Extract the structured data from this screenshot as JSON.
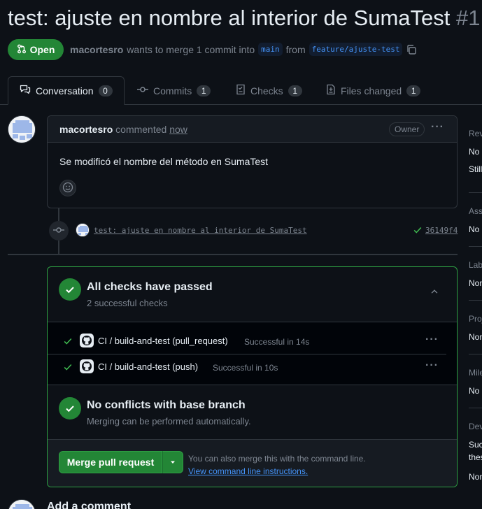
{
  "pr": {
    "title": "test: ajuste en nombre al interior de SumaTest",
    "number": "#1",
    "state": "Open",
    "author": "macortesro",
    "meta_text": "wants to merge 1 commit into",
    "base_branch": "main",
    "from_text": "from",
    "head_branch": "feature/ajuste-test"
  },
  "tabs": [
    {
      "label": "Conversation",
      "count": "0"
    },
    {
      "label": "Commits",
      "count": "1"
    },
    {
      "label": "Checks",
      "count": "1"
    },
    {
      "label": "Files changed",
      "count": "1"
    }
  ],
  "comment": {
    "author": "macortesro",
    "action": "commented",
    "time": "now",
    "role": "Owner",
    "body": "Se modificó el nombre del método en SumaTest"
  },
  "commit": {
    "message": "test: ajuste en nombre al interior de SumaTest",
    "sha": "36149f4"
  },
  "checks": {
    "title": "All checks have passed",
    "subtitle": "2 successful checks",
    "items": [
      {
        "name": "CI / build-and-test (pull_request)",
        "status": "Successful in 14s"
      },
      {
        "name": "CI / build-and-test (push)",
        "status": "Successful in 10s"
      }
    ]
  },
  "conflicts": {
    "title": "No conflicts with base branch",
    "subtitle": "Merging can be performed automatically."
  },
  "merge": {
    "button_label": "Merge pull request",
    "note": "You can also merge this with the command line.",
    "link": "View command line instructions."
  },
  "add_comment": {
    "title": "Add a comment"
  },
  "sidebar": {
    "reviewers": {
      "head": "Rev",
      "line1": "No",
      "line2": "Still"
    },
    "assignees": {
      "head": "Ass",
      "value": "No"
    },
    "labels": {
      "head": "Lab",
      "value": "Non"
    },
    "projects": {
      "head": "Proj",
      "value": "Non"
    },
    "milestone": {
      "head": "Mile",
      "value": "No"
    },
    "development": {
      "head": "Dev",
      "line1": "Suc",
      "line2": "thes",
      "value": "Non"
    }
  },
  "colors": {
    "background": "#0d1117",
    "success_green": "#238636",
    "link_blue": "#4493f8",
    "muted_text": "#7d8590"
  }
}
